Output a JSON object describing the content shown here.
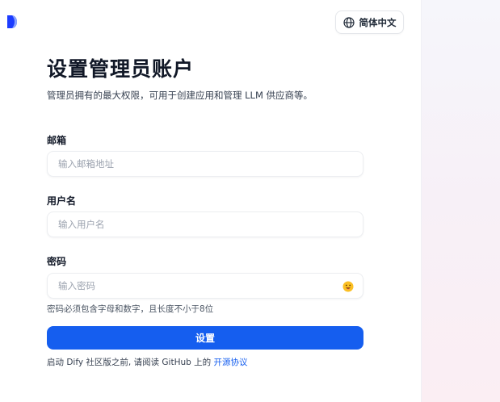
{
  "language_switcher": {
    "label": "简体中文",
    "icon": "globe-icon"
  },
  "logo": {
    "icon": "dify-logo",
    "colors": [
      "#1c3cff",
      "#89a3ff"
    ]
  },
  "header": {
    "title": "设置管理员账户",
    "subtitle": "管理员拥有的最大权限，可用于创建应用和管理 LLM 供应商等。"
  },
  "form": {
    "email": {
      "label": "邮箱",
      "placeholder": "输入邮箱地址",
      "value": ""
    },
    "username": {
      "label": "用户名",
      "placeholder": "输入用户名",
      "value": ""
    },
    "password": {
      "label": "密码",
      "placeholder": "输入密码",
      "value": "",
      "toggle_icon": "emoji-eye-toggle-icon",
      "hint": "密码必须包含字母和数字，且长度不小于8位"
    },
    "submit_label": "设置"
  },
  "footer": {
    "text_prefix": "启动 Dify 社区版之前, 请阅读 GitHub 上的",
    "link_label": "开源协议"
  },
  "colors": {
    "primary": "#155eef",
    "text": "#111827",
    "placeholder": "#9ca3af"
  }
}
